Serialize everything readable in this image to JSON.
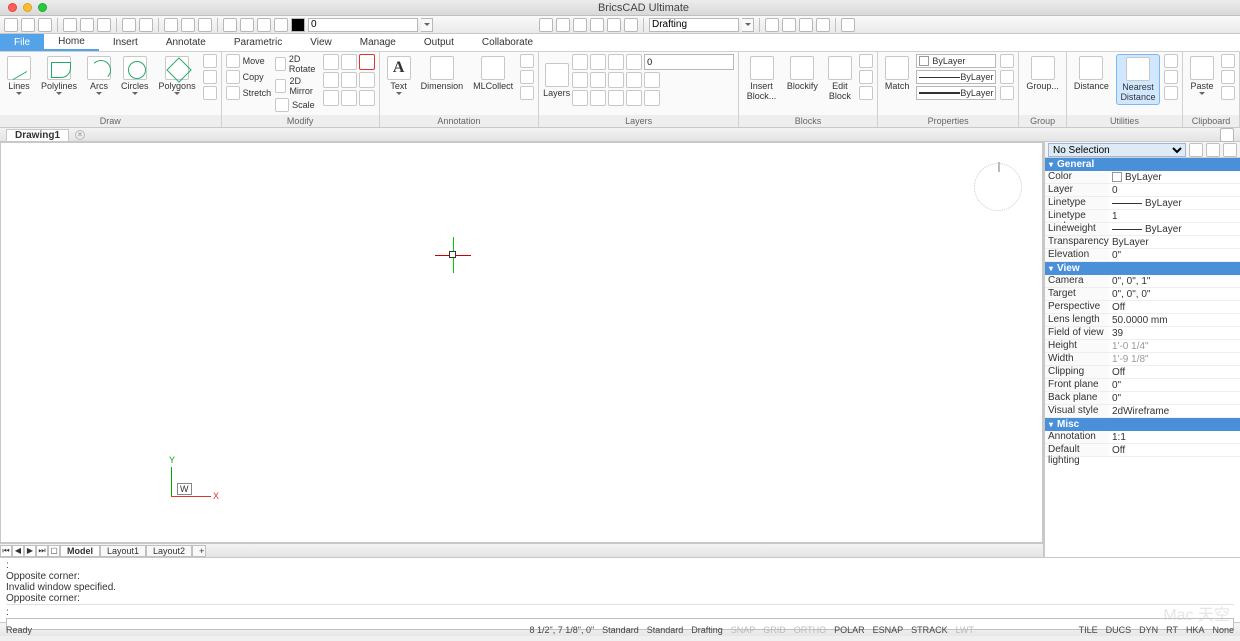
{
  "titlebar": {
    "title": "BricsCAD Ultimate"
  },
  "quick": {
    "zero": "0",
    "workspace": "Drafting"
  },
  "ribbon_tabs": {
    "file": "File",
    "tabs": [
      "Home",
      "Insert",
      "Annotate",
      "Parametric",
      "View",
      "Manage",
      "Output",
      "Collaborate"
    ],
    "active": "Home"
  },
  "ribbon": {
    "draw": {
      "title": "Draw",
      "lines": "Lines",
      "polylines": "Polylines",
      "arcs": "Arcs",
      "circles": "Circles",
      "polygons": "Polygons"
    },
    "modify": {
      "title": "Modify",
      "move": "Move",
      "copy": "Copy",
      "stretch": "Stretch",
      "rotate": "2D Rotate",
      "mirror": "2D Mirror",
      "scale": "Scale"
    },
    "annotation": {
      "title": "Annotation",
      "text": "Text",
      "dimension": "Dimension",
      "mlcollect": "MLCollect"
    },
    "layers": {
      "title": "Layers",
      "layers": "Layers",
      "combo": "0"
    },
    "blocks": {
      "title": "Blocks",
      "insert": "Insert Block...",
      "blockify": "Blockify",
      "edit": "Edit Block"
    },
    "properties": {
      "title": "Properties",
      "match": "Match",
      "bylayer": "ByLayer"
    },
    "group": {
      "title": "Group",
      "group": "Group..."
    },
    "utilities": {
      "title": "Utilities",
      "distance": "Distance",
      "nearest": "Nearest Distance"
    },
    "clipboard": {
      "title": "Clipboard",
      "paste": "Paste"
    }
  },
  "doctab": {
    "name": "Drawing1",
    "close": "×"
  },
  "canvas": {
    "ucs_y": "Y",
    "ucs_x": "X",
    "ucs_w": "W"
  },
  "layout_tabs": {
    "model": "Model",
    "l1": "Layout1",
    "l2": "Layout2",
    "plus": "+"
  },
  "props": {
    "selection": "No Selection",
    "groups": {
      "general": {
        "title": "General",
        "color_k": "Color",
        "color_v": "ByLayer",
        "layer_k": "Layer",
        "layer_v": "0",
        "linetype_k": "Linetype",
        "linetype_v": "ByLayer",
        "lts_k": "Linetype scale",
        "lts_v": "1",
        "lw_k": "Lineweight",
        "lw_v": "ByLayer",
        "tr_k": "Transparency",
        "tr_v": "ByLayer",
        "el_k": "Elevation",
        "el_v": "0\""
      },
      "view": {
        "title": "View",
        "cam_k": "Camera",
        "cam_v": "0\", 0\", 1\"",
        "tgt_k": "Target",
        "tgt_v": "0\", 0\", 0\"",
        "pers_k": "Perspective",
        "pers_v": "Off",
        "lens_k": "Lens length",
        "lens_v": "50.0000 mm",
        "fov_k": "Field of view",
        "fov_v": "39",
        "h_k": "Height",
        "h_v": "1'-0 1/4\"",
        "w_k": "Width",
        "w_v": "1'-9 1/8\"",
        "clip_k": "Clipping",
        "clip_v": "Off",
        "fp_k": "Front plane",
        "fp_v": "0\"",
        "bp_k": "Back plane",
        "bp_v": "0\"",
        "vs_k": "Visual style",
        "vs_v": "2dWireframe"
      },
      "misc": {
        "title": "Misc",
        "as_k": "Annotation sca",
        "as_v": "1:1",
        "dl_k": "Default lighting",
        "dl_v": "Off"
      }
    }
  },
  "cmd": {
    "l1": ":",
    "l2": "Opposite corner:",
    "l3": "Invalid window specified.",
    "l4": "Opposite corner:",
    "prompt": ":",
    "input": ""
  },
  "status": {
    "ready": "Ready",
    "coords": "8 1/2\", 7 1/8\", 0\"",
    "std1": "Standard",
    "std2": "Standard",
    "draft": "Drafting",
    "dim1": "SNAP",
    "dim2": "GRID",
    "dim3": "ORTHO",
    "polar": "POLAR",
    "esnap": "ESNAP",
    "strack": "STRACK",
    "lwt": "LWT",
    "tile": "TILE",
    "ducs": "DUCS",
    "dyn": "DYN",
    "rt": "RT",
    "hka": "HKA",
    "none": "None"
  },
  "watermark": "Mac 天空"
}
